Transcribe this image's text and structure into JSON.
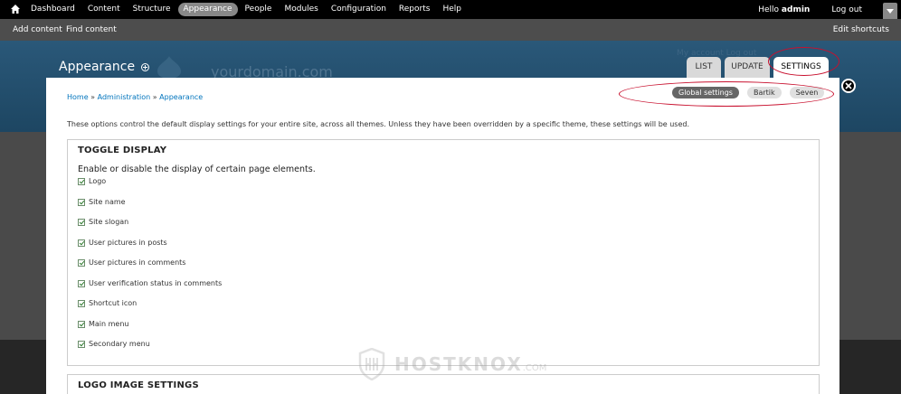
{
  "toolbar": {
    "items": [
      {
        "label": "Dashboard",
        "active": false
      },
      {
        "label": "Content",
        "active": false
      },
      {
        "label": "Structure",
        "active": false
      },
      {
        "label": "Appearance",
        "active": true
      },
      {
        "label": "People",
        "active": false
      },
      {
        "label": "Modules",
        "active": false
      },
      {
        "label": "Configuration",
        "active": false
      },
      {
        "label": "Reports",
        "active": false
      },
      {
        "label": "Help",
        "active": false
      }
    ],
    "hello": "Hello",
    "username": "admin",
    "logout": "Log out"
  },
  "shortcuts": {
    "add_content": "Add content",
    "find_content": "Find content",
    "edit_shortcuts": "Edit shortcuts"
  },
  "header": {
    "title": "Appearance",
    "site_name": "yourdomain.com",
    "faint_links": "My account   Log out"
  },
  "tabs": {
    "list": "LIST",
    "update": "UPDATE",
    "settings": "SETTINGS"
  },
  "breadcrumb": {
    "home": "Home",
    "administration": "Administration",
    "appearance": "Appearance",
    "sep": "»"
  },
  "subtabs": {
    "global": "Global settings",
    "bartik": "Bartik",
    "seven": "Seven"
  },
  "intro": "These options control the default display settings for your entire site, across all themes. Unless they have been overridden by a specific theme, these settings will be used.",
  "toggle_display": {
    "legend": "TOGGLE DISPLAY",
    "description": "Enable or disable the display of certain page elements.",
    "options": [
      {
        "label": "Logo",
        "checked": true
      },
      {
        "label": "Site name",
        "checked": true
      },
      {
        "label": "Site slogan",
        "checked": true
      },
      {
        "label": "User pictures in posts",
        "checked": true
      },
      {
        "label": "User pictures in comments",
        "checked": true
      },
      {
        "label": "User verification status in comments",
        "checked": true
      },
      {
        "label": "Shortcut icon",
        "checked": true
      },
      {
        "label": "Main menu",
        "checked": true
      },
      {
        "label": "Secondary menu",
        "checked": true
      }
    ]
  },
  "logo_settings": {
    "legend": "LOGO IMAGE SETTINGS"
  },
  "watermark": {
    "text": "HOSTKNOX",
    "suffix": ".COM"
  },
  "colors": {
    "toolbar": "#000000",
    "shortcut_bar": "#4d4d4d",
    "header_blue": "#2a5879",
    "link": "#0074bd",
    "annotation": "#c8102e"
  }
}
